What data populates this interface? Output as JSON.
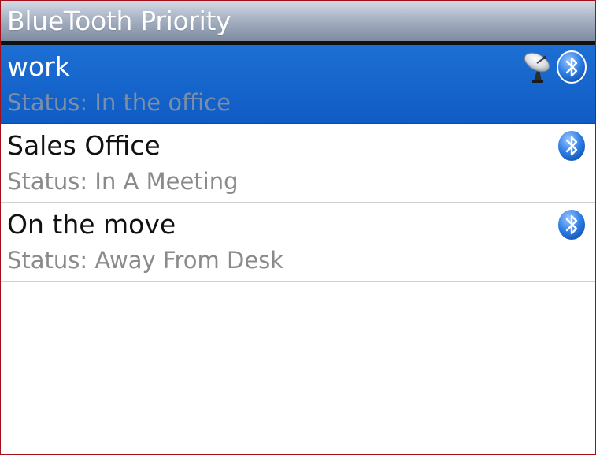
{
  "header": {
    "title": "BlueTooth Priority"
  },
  "profiles": [
    {
      "name": "work",
      "status": "Status: In the office",
      "selected": true,
      "icons": [
        "satellite-dish-icon",
        "bluetooth-icon"
      ]
    },
    {
      "name": "Sales Office",
      "status": "Status: In A Meeting",
      "selected": false,
      "icons": [
        "bluetooth-icon"
      ]
    },
    {
      "name": "On the move",
      "status": "Status: Away From Desk",
      "selected": false,
      "icons": [
        "bluetooth-icon"
      ]
    }
  ],
  "colors": {
    "selection": "#1465cc",
    "title_bar": "#a7b2c3",
    "status_text": "#8a8a8a"
  }
}
